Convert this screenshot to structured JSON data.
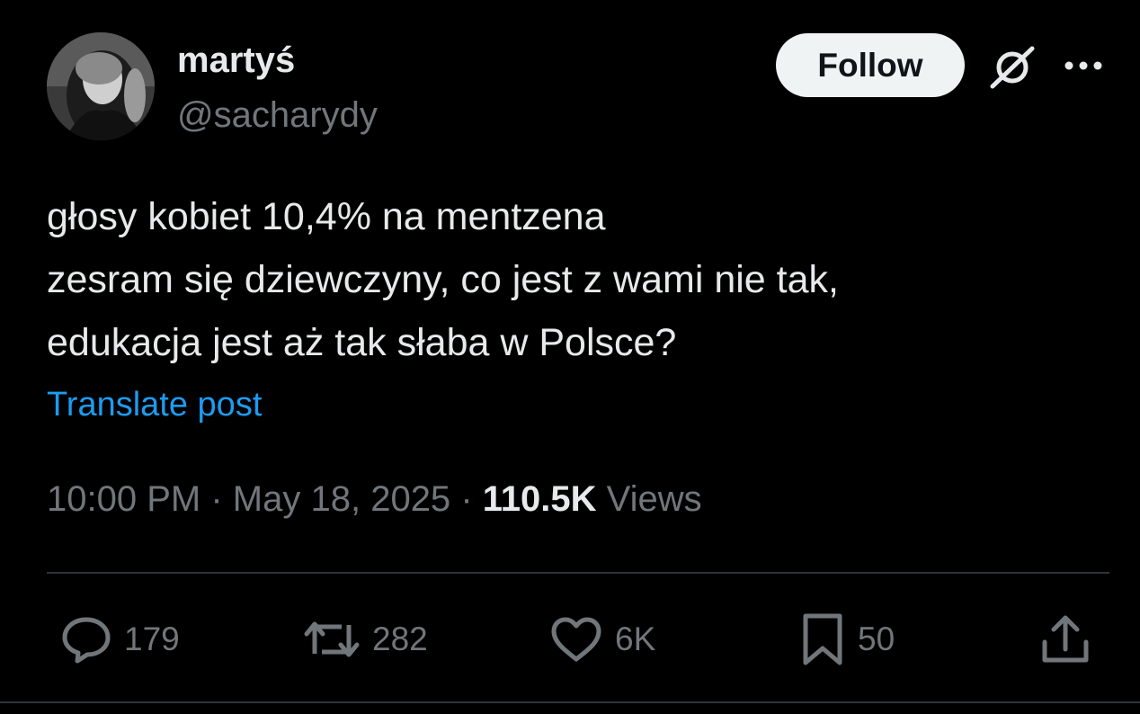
{
  "author": {
    "display_name": "martyś",
    "handle": "@sacharydy"
  },
  "header": {
    "follow_label": "Follow",
    "grok_icon": "grok-icon",
    "more_icon": "more-icon"
  },
  "post": {
    "lines": [
      "głosy kobiet 10,4% na mentzena",
      "zesram się dziewczyny, co jest z wami nie tak,",
      "edukacja jest aż tak słaba w Polsce?"
    ],
    "translate_label": "Translate post"
  },
  "meta": {
    "time": "10:00 PM",
    "separator": "·",
    "date": "May 18, 2025",
    "views_count": "110.5K",
    "views_label": "Views"
  },
  "actions": {
    "replies": "179",
    "reposts": "282",
    "likes": "6K",
    "bookmarks": "50"
  },
  "colors": {
    "background": "#000000",
    "text": "#e7e9ea",
    "secondary": "#71767b",
    "link": "#1d9bf0",
    "divider": "#2f3336",
    "follow_bg": "#eff3f4"
  }
}
